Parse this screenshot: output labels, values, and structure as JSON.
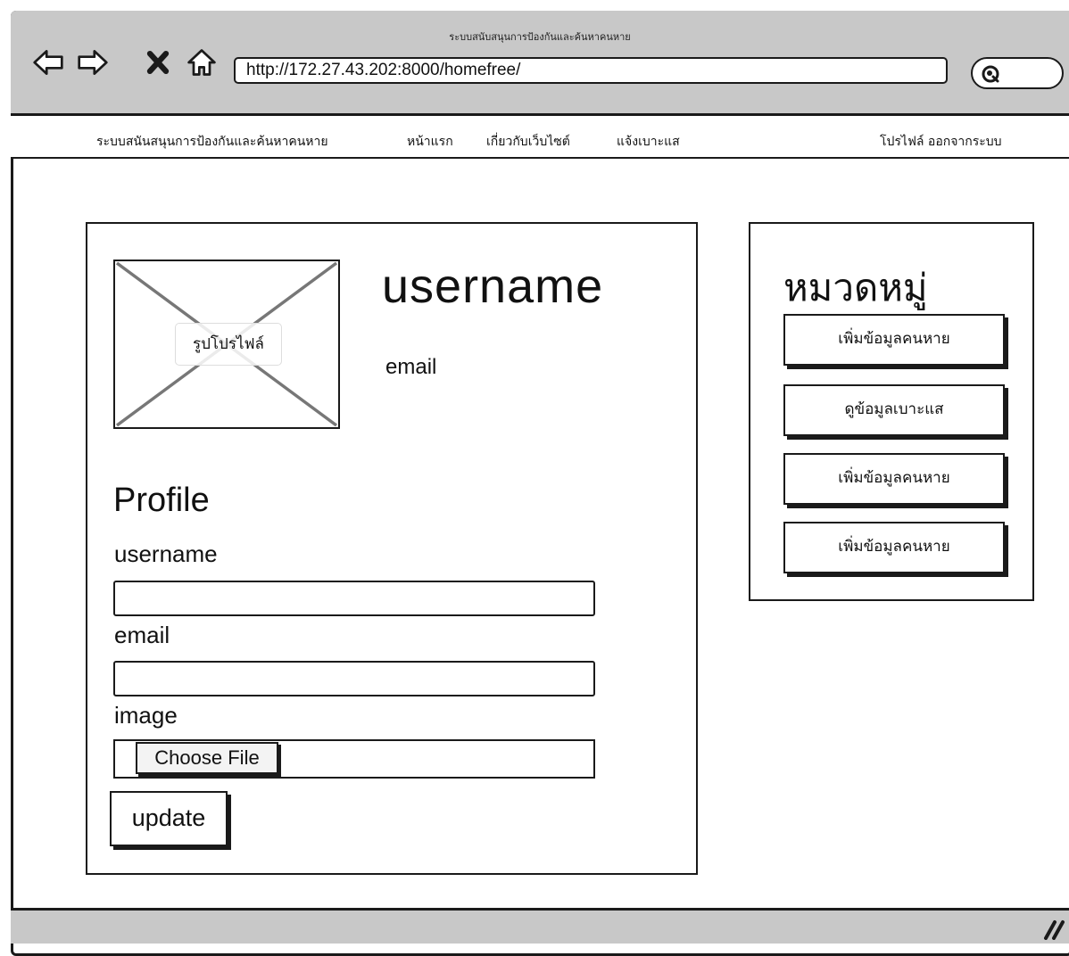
{
  "window": {
    "title": "ระบบสนับสนุนการป้องกันและค้นหาคนหาย",
    "url": "http://172.27.43.202:8000/homefree/"
  },
  "toolbar": {
    "icons": [
      "back-arrow-icon",
      "forward-arrow-icon",
      "stop-icon",
      "home-icon",
      "search-icon"
    ]
  },
  "menu": {
    "brand": "ระบบสนันสนุนการป้องกันและค้นหาคนหาย",
    "home": "หน้าแรก",
    "about": "เกี่ยวกับเว็บไซต์",
    "report": "แจ้งเบาะแส",
    "profile_logout": "โปรไฟล์ ออกจากระบบ"
  },
  "profile": {
    "image_label": "รูปโปรไฟล์",
    "username": "username",
    "email": "email"
  },
  "form": {
    "title": "Profile",
    "username_label": "username",
    "username_value": "",
    "email_label": "email",
    "email_value": "",
    "image_label": "image",
    "choose_file_label": "Choose File",
    "update_label": "update"
  },
  "category": {
    "title": "หมวดหมู่",
    "items": [
      "เพิ่มข้อมูลคนหาย",
      "ดูข้อมูลเบาะแส",
      "เพิ่มข้อมูลคนหาย",
      "เพิ่มข้อมูลคนหาย"
    ]
  },
  "colors": {
    "chrome_gray": "#c8c8c8",
    "ink": "#1a1a1a"
  }
}
